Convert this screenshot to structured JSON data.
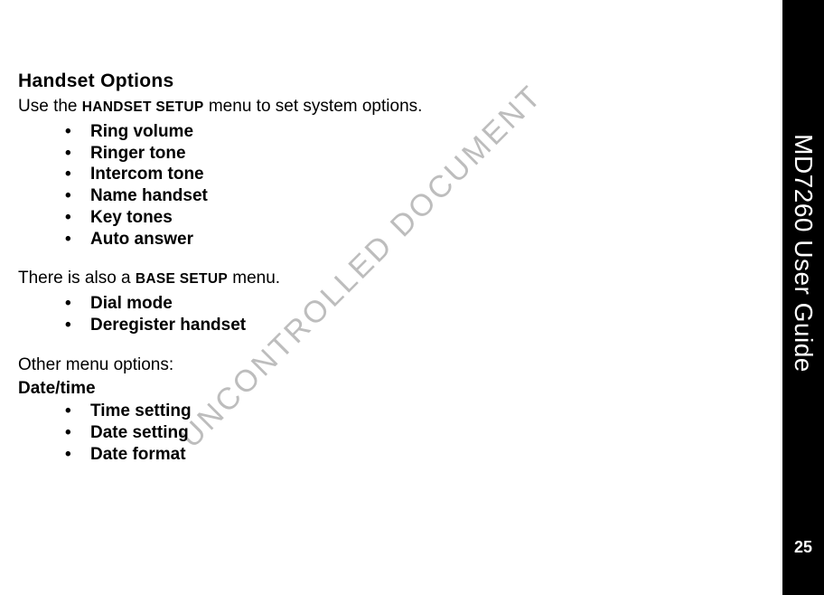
{
  "sidebar": {
    "title": "MD7260 User Guide",
    "page_number": "25"
  },
  "watermark": "UNCONTROLLED DOCUMENT",
  "section": {
    "heading": "Handset Options",
    "intro_prefix": "Use the ",
    "intro_menu": "HANDSET SETUP",
    "intro_suffix": " menu to set system options.",
    "handset_items": [
      "Ring volume",
      "Ringer tone",
      "Intercom tone",
      "Name handset",
      "Key tones",
      "Auto answer"
    ],
    "base_prefix": "There is also a ",
    "base_menu": "BASE SETUP",
    "base_suffix": " menu.",
    "base_items": [
      "Dial mode",
      "Deregister handset"
    ],
    "other_label": "Other menu options:",
    "datetime_label": "Date/time",
    "datetime_items": [
      "Time setting",
      "Date setting",
      "Date format"
    ]
  }
}
